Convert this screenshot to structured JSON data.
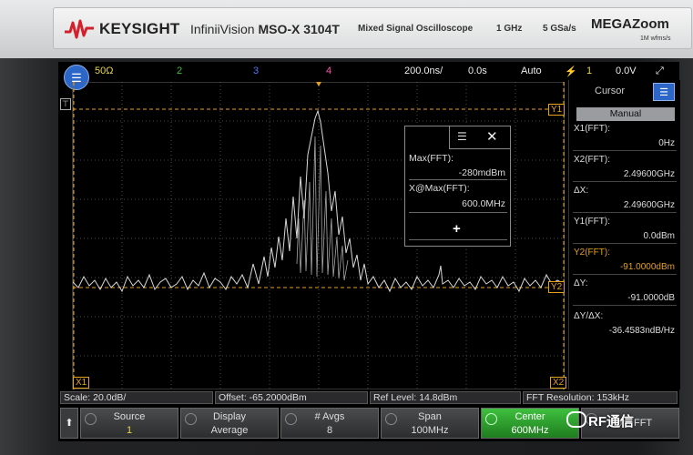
{
  "brand": {
    "company": "KEYSIGHT",
    "model_bold": "InfiniiVision",
    "model": "MSO-X 3104T",
    "subtitle": "Mixed Signal Oscilloscope",
    "bandwidth": "1 GHz",
    "sample_rate": "5 GSa/s",
    "megazoom": "MEGAZoom",
    "megazoom_sub": "1M wfms/s"
  },
  "status": {
    "ch1": "50Ω",
    "ch2": "2",
    "ch3": "3",
    "ch4": "4",
    "timebase": "200.0ns/",
    "delay": "0.0s",
    "trigger_mode": "Auto",
    "trigger_icon": "⚡",
    "trigger_channel": "1",
    "trigger_level": "0.0V",
    "run_icon": "⤢"
  },
  "markers": {
    "y1": "Y1",
    "y2": "Y2",
    "x1": "X1",
    "x2": "X2"
  },
  "popup": {
    "max_label": "Max(FFT):",
    "max_value": "-280mdBm",
    "xmax_label": "X@Max(FFT):",
    "xmax_value": "600.0MHz",
    "plus": "+"
  },
  "cursor_panel": {
    "title": "Cursor",
    "mode": "Manual",
    "x1_label": "X1(FFT):",
    "x1_value": "0Hz",
    "x2_label": "X2(FFT):",
    "x2_value": "2.49600GHz",
    "dx_label": "ΔX:",
    "dx_value": "2.49600GHz",
    "y1_label": "Y1(FFT):",
    "y1_value": "0.0dBm",
    "y2_label": "Y2(FFT):",
    "y2_value": "-91.0000dBm",
    "dy_label": "ΔY:",
    "dy_value": "-91.0000dB",
    "dydx_label": "ΔY/ΔX:",
    "dydx_value": "-36.4583ndB/Hz"
  },
  "infobar": {
    "scale": "Scale: 20.0dB/",
    "offset": "Offset: -65.2000dBm",
    "ref_level": "Ref Level: 14.8dBm",
    "fft_res": "FFT Resolution: 153kHz"
  },
  "softkeys": [
    {
      "label": "Source",
      "value": "1"
    },
    {
      "label": "Display",
      "value": "Average"
    },
    {
      "label": "# Avgs",
      "value": "8"
    },
    {
      "label": "Span",
      "value": "100MHz"
    },
    {
      "label": "Center",
      "value": "600MHz"
    },
    {
      "label": "More FFT",
      "value": ""
    }
  ],
  "back_label": "⬆",
  "watermark": "RF通信",
  "colors": {
    "ch1": "#e6d64a",
    "ch2": "#3fbf3f",
    "ch3": "#5577ff",
    "ch4": "#ff55aa",
    "cursor": "#e6a020",
    "accent": "#2b66c8",
    "active_key": "#3fbf3f"
  }
}
